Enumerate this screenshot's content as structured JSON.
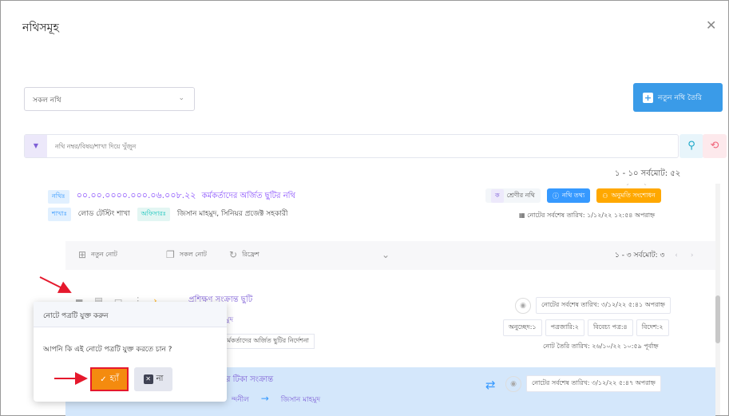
{
  "dialog": {
    "title": "নথিসমূহ",
    "close_icon": "close-icon"
  },
  "filter": {
    "selected": "সকল নথি"
  },
  "new_file_button": {
    "label": "নতুন নথি তৈরি",
    "icon": "plus-square-icon"
  },
  "search": {
    "placeholder": "নথি নম্বর/বিষয়/শাখা দিয়ে খুঁজুন"
  },
  "pager": {
    "text": "১ - ১০ সর্বমোট: ৫২"
  },
  "file": {
    "label": "নথিঃ",
    "number": "০০.০০.০০০০.০০০.০৬.০০৮.২২",
    "subject": "কর্মকর্তাদের অর্জিত ছুটির নথি",
    "branch_label": "শাখাঃ",
    "branch": "লোড টেস্টিং শাখা",
    "office_label": "অফিসারঃ",
    "officer": "জিসান মাহমুদ, সিনিয়র প্রজেক্ট সহকারী",
    "class_label": "শ্রেণীর নথি",
    "class_value": "ক",
    "info_button": "নথি তথ্য",
    "permission_button": "অনুমতি সংশোধন",
    "last_note_date": "নোটের সর্বশেষ তারিখ: ১/১২/২২ ১২:৫৪ অপরাহ্ন"
  },
  "notes_toolbar": {
    "new_note": "নতুন নোট",
    "all_notes": "সকল নোট",
    "refresh": "রিফ্রেশ",
    "pager": "১ - ৩ সর্বমোট: ৩"
  },
  "note1": {
    "title": "প্রশিক্ষণ সংক্রান্ত ছুটি",
    "author": "মাহমুদ",
    "subject": "কর্মকর্তাদের অর্জিত ছুটির নির্দেশনা",
    "last_date": "নোটের সর্বশেষ তারিখ: ৩/১২/২২ ৫:৪১ অপরাহ্ন",
    "counts": [
      "অনুচ্ছেদ:১",
      "পত্রজারি:২",
      "বিবেচ্য পত্র:৪",
      "বিদেশ:২"
    ],
    "created": "নোট তৈরি তারিখ: ২৬/১০/২২ ১০:৫৯ পূর্বাহ্ন"
  },
  "note2": {
    "title": "র টিকা সংক্রান্ত",
    "from": "ন্দনীল",
    "to": "জিসান মাহমুদ",
    "last_date": "নোটের সর্বশেষ তারিখ: ৩/১২/২২ ৫:৪৭ অপরাহ্ন"
  },
  "popup": {
    "title": "নোটে পত্রটি যুক্ত করুন",
    "question": "আপনি কি এই নোটে পত্রটি যুক্ত করতে চান ?",
    "yes": "হ্যাঁ",
    "no": "না"
  },
  "colors": {
    "accent_purple": "#8950fc",
    "primary_blue": "#3699ff",
    "yes_orange": "#f48b0f",
    "annotation_red": "#e5182c"
  }
}
